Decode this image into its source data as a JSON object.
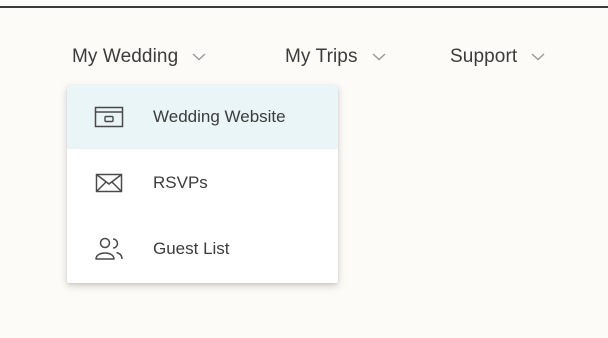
{
  "nav": {
    "items": [
      {
        "label": "My Wedding",
        "icon": "chevron-down-icon"
      },
      {
        "label": "My Trips",
        "icon": "chevron-down-icon"
      },
      {
        "label": "Support",
        "icon": "chevron-down-icon"
      }
    ]
  },
  "dropdown": {
    "items": [
      {
        "label": "Wedding Website",
        "icon": "browser-window-icon",
        "active": true
      },
      {
        "label": "RSVPs",
        "icon": "envelope-icon",
        "active": false
      },
      {
        "label": "Guest List",
        "icon": "people-icon",
        "active": false
      }
    ]
  },
  "colors": {
    "background": "#fdfbf7",
    "text": "#3c3c3c",
    "active_item_bg": "#e9f5f6",
    "icon_stroke": "#4a4a4a",
    "top_border": "#3a3a3a"
  }
}
